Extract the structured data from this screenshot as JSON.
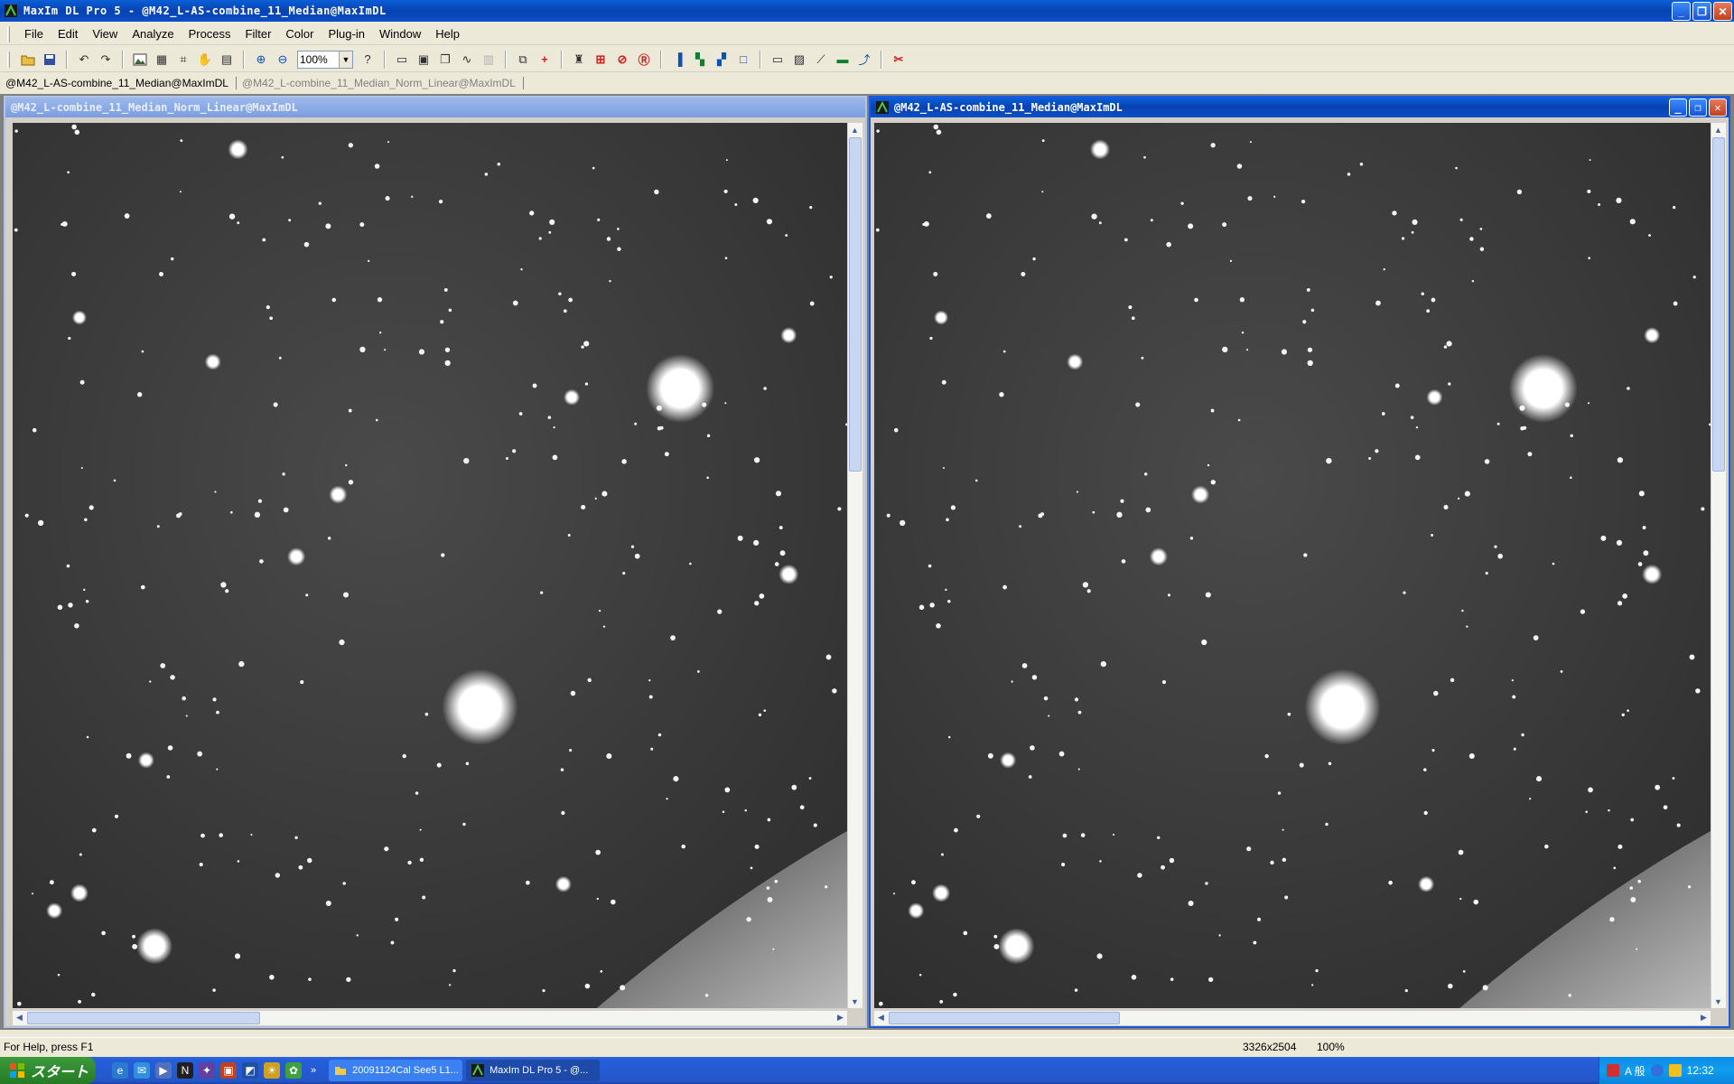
{
  "window": {
    "title": "MaxIm DL Pro 5 - @M42_L-AS-combine_11_Median@MaxImDL",
    "minimize": "_",
    "restore": "❐",
    "close": "✕"
  },
  "menu": [
    "File",
    "Edit",
    "View",
    "Analyze",
    "Process",
    "Filter",
    "Color",
    "Plug-in",
    "Window",
    "Help"
  ],
  "toolbar": {
    "zoom_value": "100%"
  },
  "window_tabs": [
    "@M42_L-AS-combine_11_Median@MaxImDL",
    "@M42_L-combine_11_Median_Norm_Linear@MaxImDL"
  ],
  "left_image": {
    "title": "@M42_L-combine_11_Median_Norm_Linear@MaxImDL"
  },
  "right_image": {
    "title": "@M42_L-AS-combine_11_Median@MaxImDL"
  },
  "status": {
    "help": "For Help, press F1",
    "dimensions": "3326x2504",
    "zoom": "100%"
  },
  "taskbar": {
    "start": "スタート",
    "more": "»",
    "tasks": [
      "20091124Cal See5 L1...",
      "MaxIm DL Pro 5 - @..."
    ],
    "ime": "A 般",
    "clock": "12:32"
  },
  "colors": {
    "title_blue": "#0a4fc8",
    "taskbar_blue": "#245edb",
    "start_green": "#2f8a2f",
    "face": "#ece9d8"
  }
}
